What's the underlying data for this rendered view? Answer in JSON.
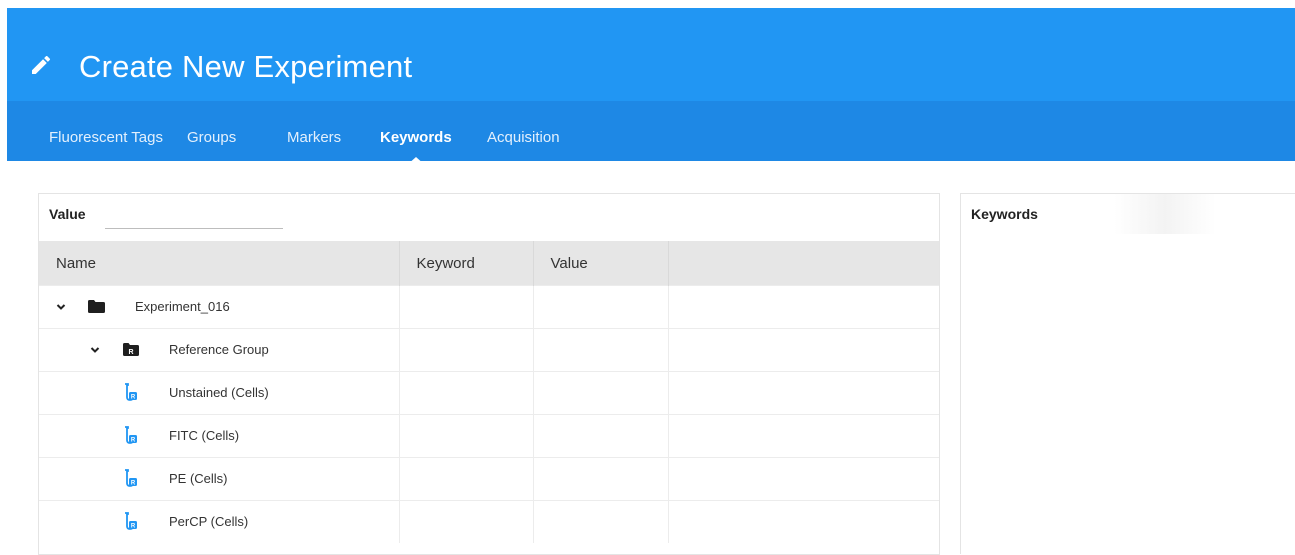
{
  "header": {
    "title": "Create New Experiment",
    "icon": "pencil-icon",
    "color": "#2196f3",
    "tabs_color": "#1e88e5"
  },
  "tabs": [
    {
      "label": "Fluorescent Tags",
      "active": false
    },
    {
      "label": "Groups",
      "active": false
    },
    {
      "label": "Markers",
      "active": false
    },
    {
      "label": "Keywords",
      "active": true
    },
    {
      "label": "Acquisition",
      "active": false
    }
  ],
  "left_panel": {
    "value_label": "Value",
    "value_input": "",
    "columns": [
      "Name",
      "Keyword",
      "Value",
      ""
    ],
    "rows": [
      {
        "name": "Experiment_016",
        "icon": "folder-icon",
        "expanded": true,
        "keyword": "",
        "value": ""
      },
      {
        "name": "Reference Group",
        "icon": "reference-folder-icon",
        "expanded": true,
        "keyword": "",
        "value": ""
      },
      {
        "name": "Unstained (Cells)",
        "icon": "tube-icon",
        "keyword": "",
        "value": ""
      },
      {
        "name": "FITC (Cells)",
        "icon": "tube-icon",
        "keyword": "",
        "value": ""
      },
      {
        "name": "PE (Cells)",
        "icon": "tube-icon",
        "keyword": "",
        "value": ""
      },
      {
        "name": "PerCP (Cells)",
        "icon": "tube-icon",
        "keyword": "",
        "value": ""
      }
    ]
  },
  "right_panel": {
    "title": "Keywords"
  }
}
